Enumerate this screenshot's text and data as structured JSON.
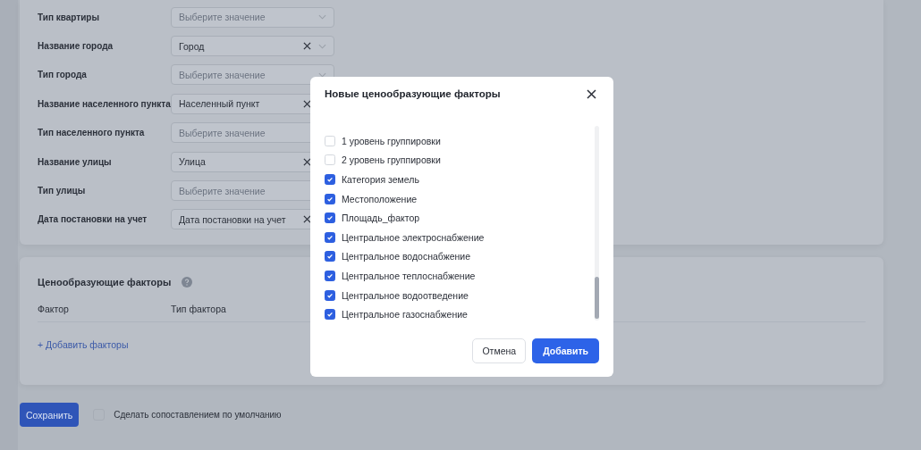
{
  "form": {
    "fields": [
      {
        "label": "Тип квартиры",
        "placeholder": "Выберите значение",
        "clearable": false
      },
      {
        "label": "Название города",
        "value": "Город",
        "clearable": true
      },
      {
        "label": "Тип города",
        "placeholder": "Выберите значение",
        "clearable": false
      },
      {
        "label": "Название населенного пункта",
        "value": "Населенный пункт",
        "clearable": true
      },
      {
        "label": "Тип населенного пункта",
        "placeholder": "Выберите значение",
        "clearable": false
      },
      {
        "label": "Название улицы",
        "value": "Улица",
        "clearable": true
      },
      {
        "label": "Тип улицы",
        "placeholder": "Выберите значение",
        "clearable": false
      },
      {
        "label": "Дата постановки на учет",
        "value": "Дата постановки на учет",
        "clearable": true
      }
    ]
  },
  "factors_section": {
    "title": "Ценообразующие факторы",
    "columns": [
      "Фактор",
      "Тип фактора"
    ],
    "add_link": "+ Добавить факторы"
  },
  "footer": {
    "save_button": "Сохранить",
    "default_checkbox": {
      "label": "Сделать сопоставлением по умолчанию",
      "checked": false
    }
  },
  "modal": {
    "title": "Новые ценообразующие факторы",
    "options": [
      {
        "label": "1 уровень группировки",
        "checked": false
      },
      {
        "label": "2 уровень группировки",
        "checked": false
      },
      {
        "label": "Категория земель",
        "checked": true
      },
      {
        "label": "Местоположение",
        "checked": true
      },
      {
        "label": "Площадь_фактор",
        "checked": true
      },
      {
        "label": "Центральное электроснабжение",
        "checked": true
      },
      {
        "label": "Центральное водоснабжение",
        "checked": true
      },
      {
        "label": "Центральное теплоснабжение",
        "checked": true
      },
      {
        "label": "Центральное водоотведение",
        "checked": true
      },
      {
        "label": "Центральное газоснабжение",
        "checked": true
      }
    ],
    "buttons": [
      {
        "label": "Отмена",
        "kind": "secondary"
      },
      {
        "label": "Добавить",
        "kind": "primary"
      }
    ]
  }
}
